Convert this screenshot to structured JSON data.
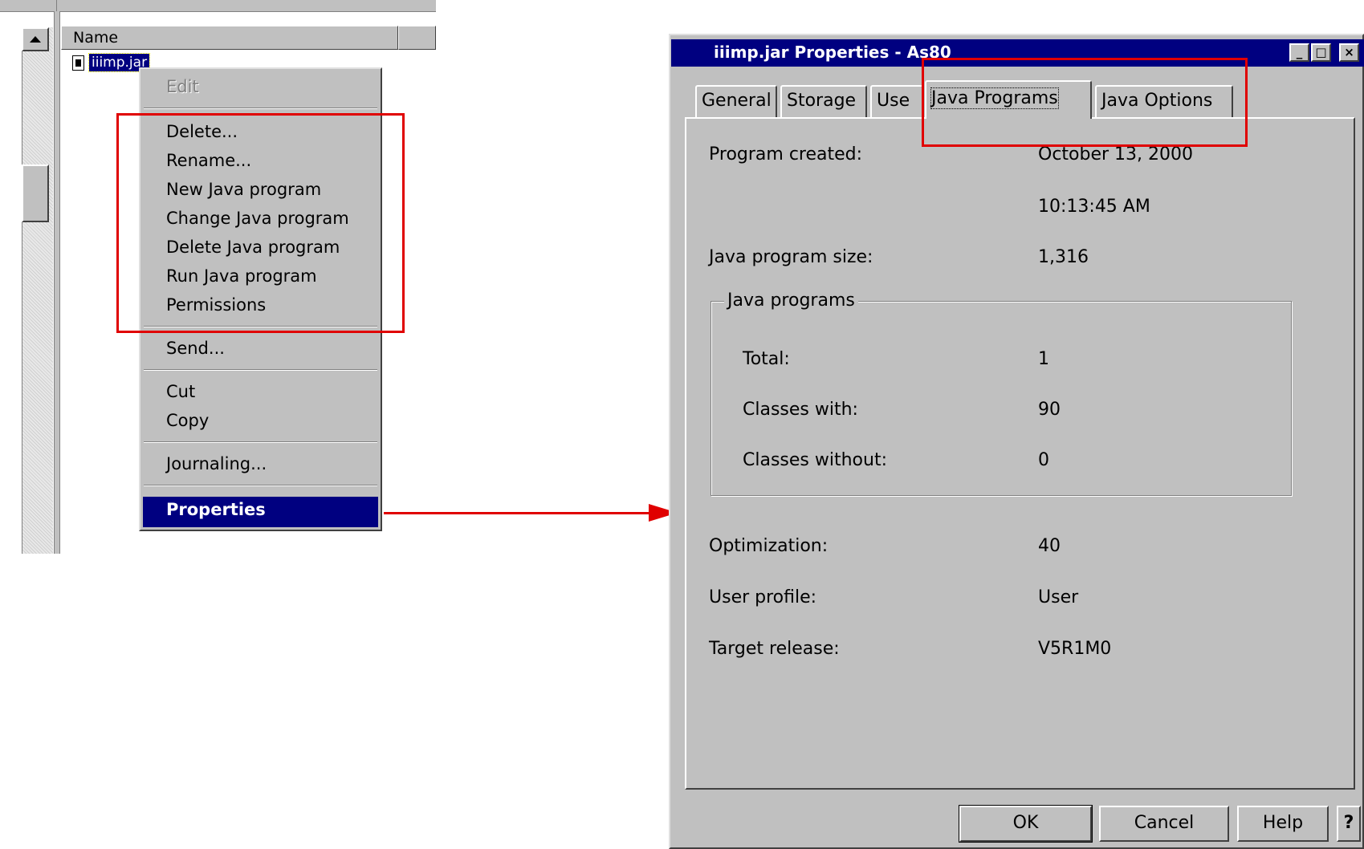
{
  "explorer": {
    "column_header": "Name",
    "file_name": "iiimp.jar"
  },
  "context_menu": {
    "items": [
      {
        "label": "Edit",
        "enabled": false
      },
      {
        "label": "Delete..."
      },
      {
        "label": "Rename..."
      },
      {
        "label": "New Java program"
      },
      {
        "label": "Change Java program"
      },
      {
        "label": "Delete Java program"
      },
      {
        "label": "Run Java program"
      },
      {
        "label": "Permissions"
      },
      {
        "label": "Send..."
      },
      {
        "label": "Cut"
      },
      {
        "label": "Copy"
      },
      {
        "label": "Journaling..."
      },
      {
        "label": "Properties",
        "selected": true
      }
    ]
  },
  "dialog": {
    "title": "iiimp.jar Properties - As80",
    "window_buttons": {
      "minimize": "_",
      "maximize": "□",
      "close": "×"
    },
    "tabs": [
      "General",
      "Storage",
      "Use",
      "Java Programs",
      "Java Options"
    ],
    "active_tab": "Java Programs",
    "fields": {
      "program_created_label": "Program created:",
      "program_created_date": "October 13, 2000",
      "program_created_time": "10:13:45 AM",
      "size_label": "Java program size:",
      "size_value": "1,316",
      "optimization_label": "Optimization:",
      "optimization_value": "40",
      "user_profile_label": "User profile:",
      "user_profile_value": "User",
      "target_release_label": "Target release:",
      "target_release_value": "V5R1M0"
    },
    "group": {
      "title": "Java programs",
      "total_label": "Total:",
      "total_value": "1",
      "with_label": "Classes with:",
      "with_value": "90",
      "without_label": "Classes without:",
      "without_value": "0"
    },
    "buttons": {
      "ok": "OK",
      "cancel": "Cancel",
      "help": "Help",
      "question": "?"
    }
  },
  "colors": {
    "annotation": "#e00000",
    "titlebar": "#000080",
    "face": "#c0c0c0"
  }
}
